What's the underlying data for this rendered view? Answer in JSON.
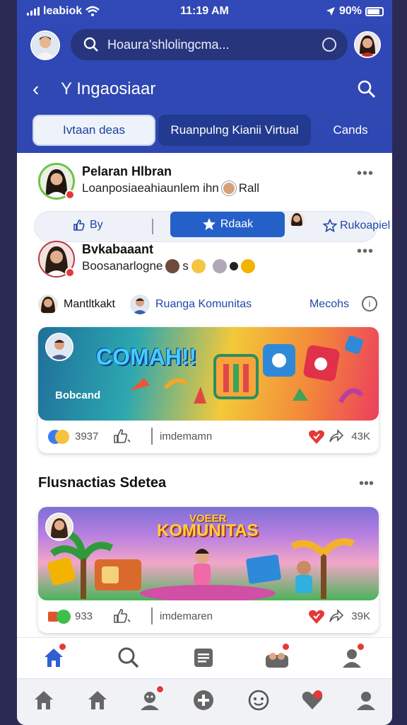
{
  "status": {
    "carrier": "leabiok",
    "time": "11:19 AM",
    "battery": "90%"
  },
  "search": {
    "placeholder": "Hoaura'shlolingcma..."
  },
  "titlebar": {
    "title": "Y Ingaosiaar"
  },
  "tabs": [
    {
      "label": "Ivtaan deas"
    },
    {
      "label": "Ruanpulng Kianii Virtual"
    },
    {
      "label": "Cands"
    }
  ],
  "posts": [
    {
      "name": "Pelaran Hlbran",
      "subtitle": "Loanposiaeahiaunlem ihn",
      "extra": "Rall",
      "actions": {
        "like": "By",
        "primary": "Rdaak",
        "share": "Rukoapiel"
      }
    },
    {
      "name": "Bvkabaaant",
      "subtitle": "Boosanarlogne",
      "extra": "s"
    }
  ],
  "community_row": {
    "user": "Mantltkakt",
    "group": "Ruanga Komunitas",
    "link": "Mecohs",
    "info_icon": "i"
  },
  "cards": [
    {
      "banner_title": "COMAH!!",
      "banner_caption": "Bobcand",
      "count_left": "3937",
      "label": "imdemamn",
      "count_right": "43K"
    },
    {
      "banner_title": "KOMUNITAS",
      "banner_kicker": "VOEER",
      "count_left": "933",
      "label": "imdemaren",
      "count_right": "39K"
    }
  ],
  "section": {
    "title": "Flusnactias Sdetea",
    "more": "•••"
  },
  "more_icon": "•••",
  "colors": {
    "header": "#3149b7",
    "accent": "#2560c9",
    "badge": "#e53935"
  }
}
